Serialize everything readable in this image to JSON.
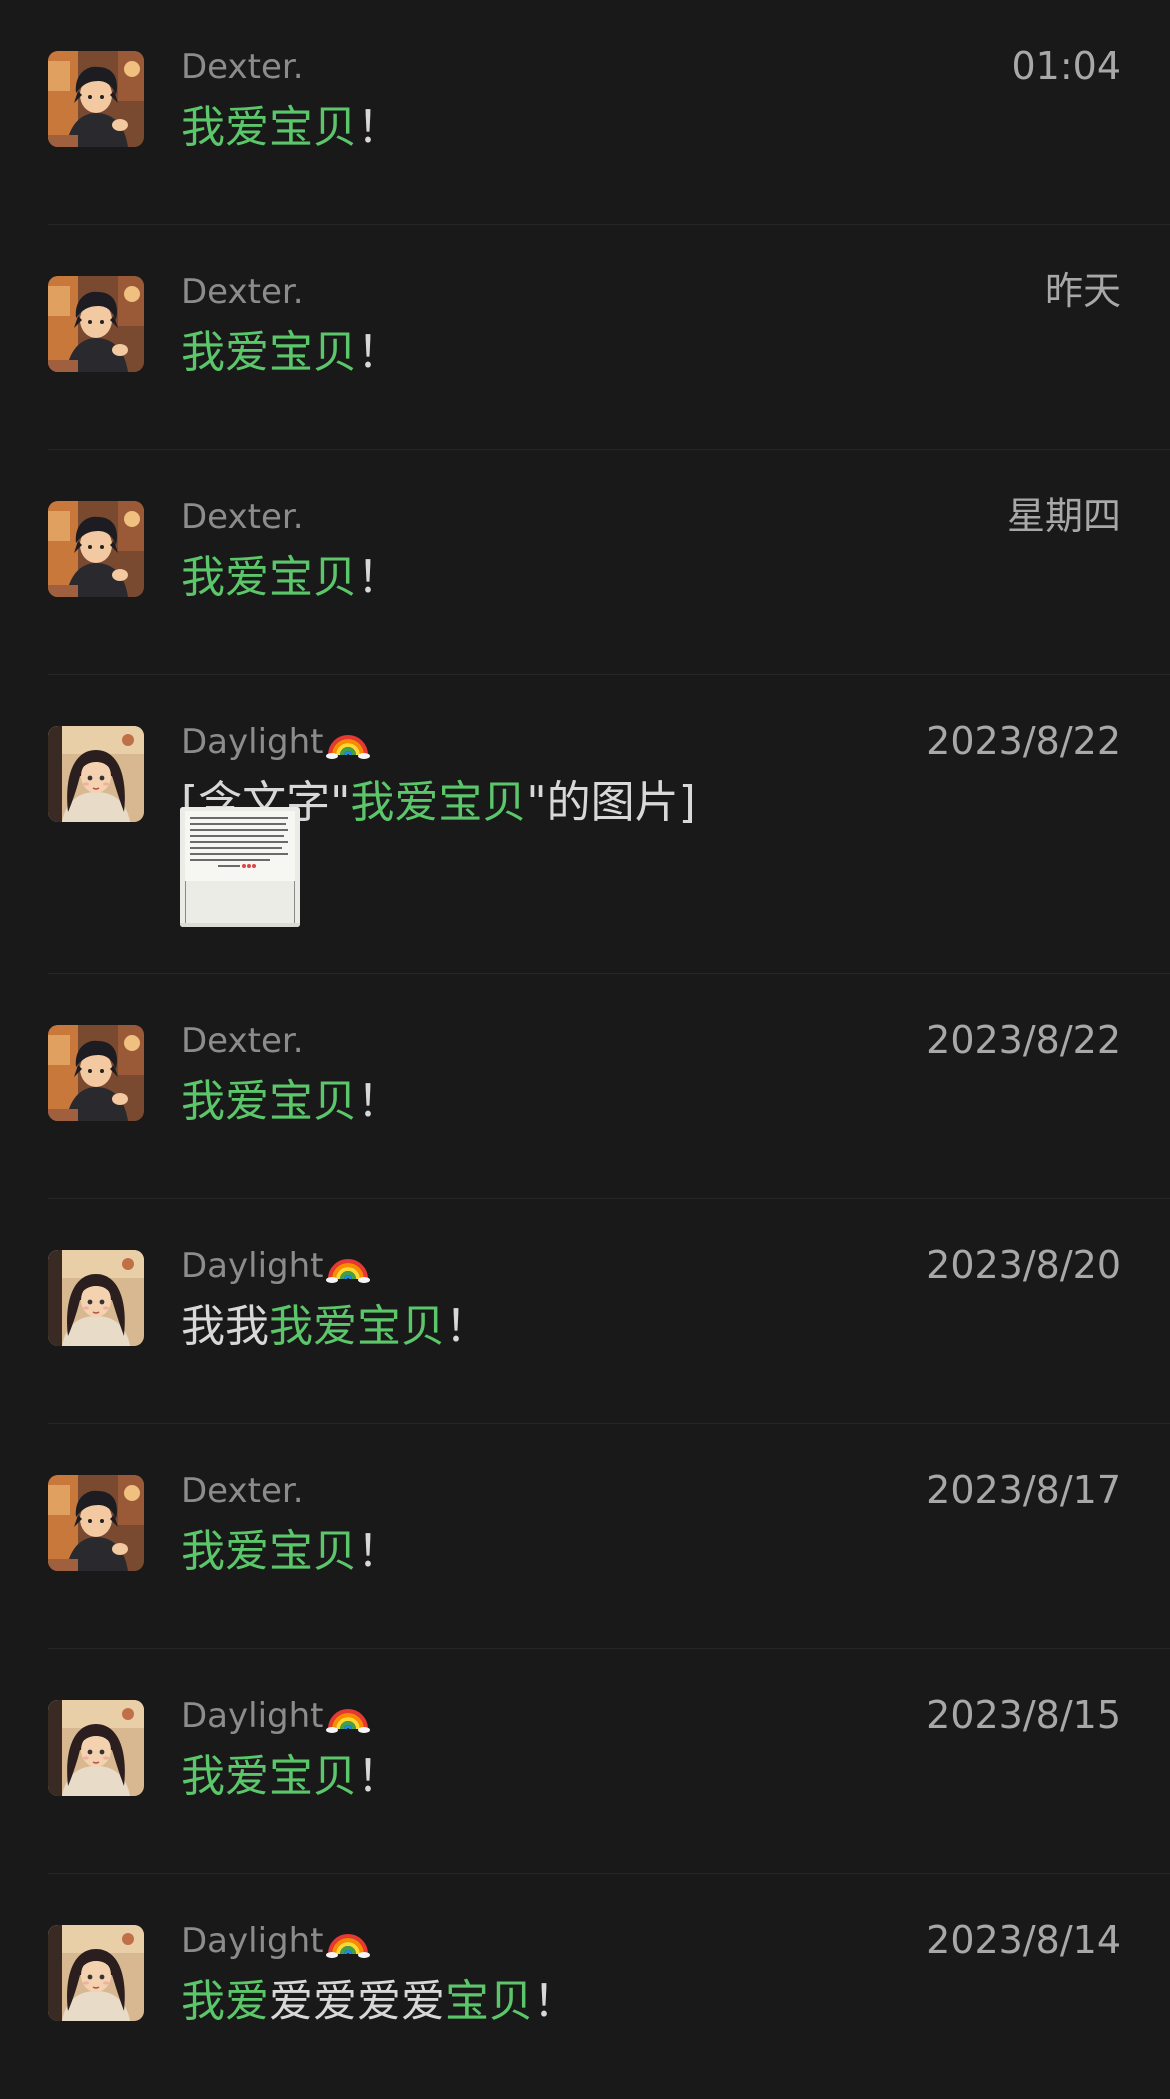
{
  "chats": [
    {
      "name": "Dexter.",
      "time": "01:04",
      "avatar": "boy-avatar-icon",
      "message": [
        {
          "t": "我爱宝贝",
          "hl": true
        },
        {
          "t": "！",
          "hl": false
        }
      ]
    },
    {
      "name": "Dexter.",
      "time": "昨天",
      "avatar": "boy-avatar-icon",
      "message": [
        {
          "t": "我爱宝贝",
          "hl": true
        },
        {
          "t": "！",
          "hl": false
        }
      ]
    },
    {
      "name": "Dexter.",
      "time": "星期四",
      "avatar": "boy-avatar-icon",
      "message": [
        {
          "t": "我爱宝贝",
          "hl": true
        },
        {
          "t": "！",
          "hl": false
        }
      ]
    },
    {
      "name": "Daylight",
      "time": "2023/8/22",
      "avatar": "girl-avatar-icon",
      "rainbow": true,
      "has_image": true,
      "message": [
        {
          "t": "[含文字\"",
          "hl": false
        },
        {
          "t": "我爱宝贝",
          "hl": true
        },
        {
          "t": "\"的图片]",
          "hl": false
        }
      ]
    },
    {
      "name": "Dexter.",
      "time": "2023/8/22",
      "avatar": "boy-avatar-icon",
      "message": [
        {
          "t": "我爱宝贝",
          "hl": true
        },
        {
          "t": "！",
          "hl": false
        }
      ]
    },
    {
      "name": "Daylight",
      "time": "2023/8/20",
      "avatar": "girl-avatar-icon",
      "rainbow": true,
      "message": [
        {
          "t": "我我",
          "hl": false
        },
        {
          "t": "我爱宝贝",
          "hl": true
        },
        {
          "t": "！",
          "hl": false
        }
      ]
    },
    {
      "name": "Dexter.",
      "time": "2023/8/17",
      "avatar": "boy-avatar-icon",
      "message": [
        {
          "t": "我爱宝贝",
          "hl": true
        },
        {
          "t": "！",
          "hl": false
        }
      ]
    },
    {
      "name": "Daylight",
      "time": "2023/8/15",
      "avatar": "girl-avatar-icon",
      "rainbow": true,
      "message": [
        {
          "t": "我爱宝贝",
          "hl": true
        },
        {
          "t": "！",
          "hl": false
        }
      ]
    },
    {
      "name": "Daylight",
      "time": "2023/8/14",
      "avatar": "girl-avatar-icon",
      "rainbow": true,
      "message": [
        {
          "t": "我爱",
          "hl": true
        },
        {
          "t": "爱爱爱爱",
          "hl": false
        },
        {
          "t": "宝贝",
          "hl": true
        },
        {
          "t": "！",
          "hl": false
        }
      ]
    }
  ],
  "colors": {
    "background": "#191919",
    "highlight": "#5bc76a",
    "name": "#8c8c8c",
    "time": "#a8a8a8",
    "text": "#d8d8d8"
  }
}
